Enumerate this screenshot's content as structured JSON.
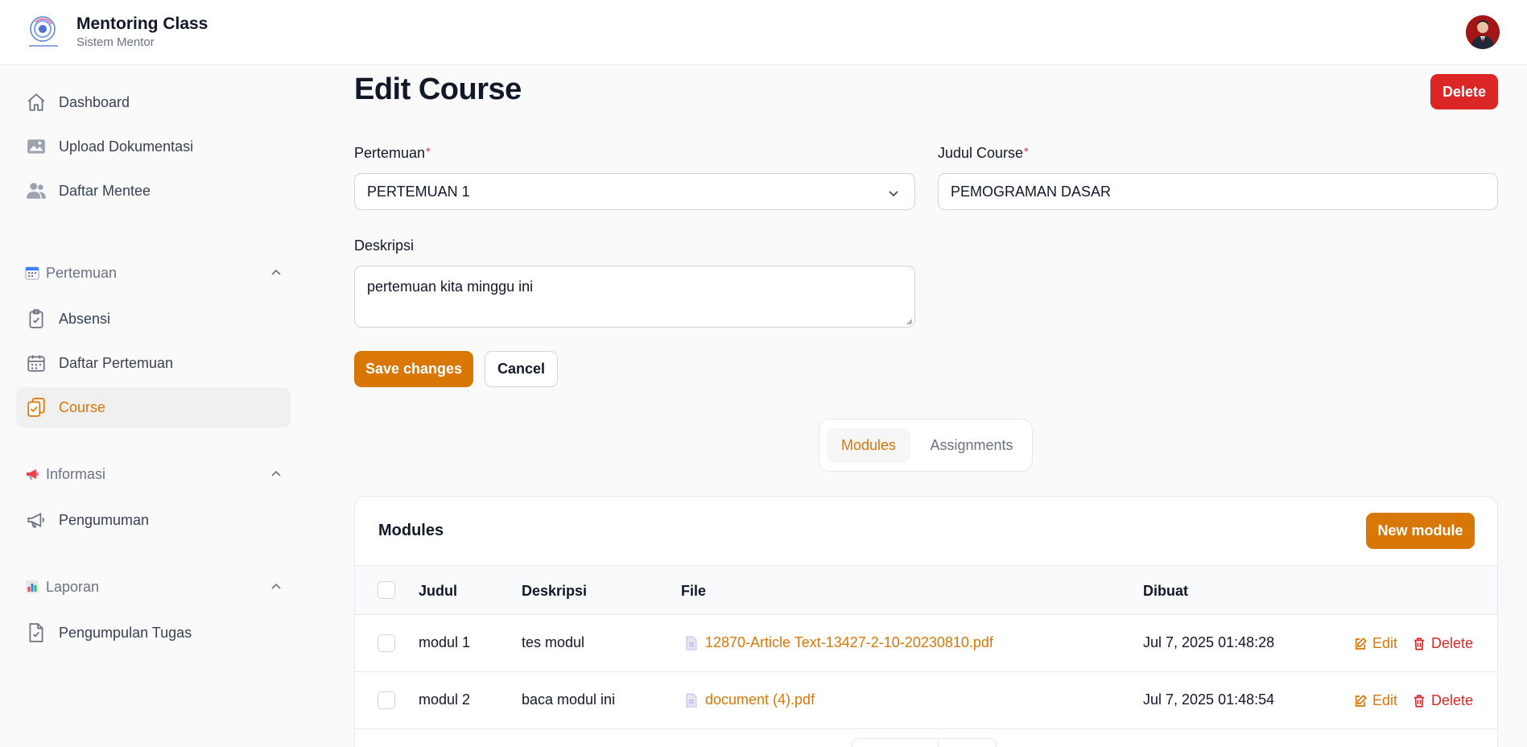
{
  "app": {
    "title": "Mentoring Class",
    "subtitle": "Sistem Mentor"
  },
  "sidebar": {
    "items": [
      {
        "label": "Dashboard",
        "icon": "home-icon"
      },
      {
        "label": "Upload Dokumentasi",
        "icon": "image-icon"
      },
      {
        "label": "Daftar Mentee",
        "icon": "users-icon"
      }
    ],
    "groups": [
      {
        "label": "Pertemuan",
        "icon": "calendar-emoji-icon",
        "items": [
          {
            "label": "Absensi",
            "icon": "clipboard-check-icon"
          },
          {
            "label": "Daftar Pertemuan",
            "icon": "calendar-icon"
          },
          {
            "label": "Course",
            "icon": "clipboard-copy-icon",
            "active": true
          }
        ]
      },
      {
        "label": "Informasi",
        "icon": "megaphone-emoji-icon",
        "items": [
          {
            "label": "Pengumuman",
            "icon": "megaphone-icon"
          }
        ]
      },
      {
        "label": "Laporan",
        "icon": "bar-chart-emoji-icon",
        "items": [
          {
            "label": "Pengumpulan Tugas",
            "icon": "document-check-icon"
          }
        ]
      }
    ]
  },
  "page": {
    "title": "Edit Course",
    "delete_label": "Delete"
  },
  "form": {
    "pertemuan": {
      "label": "Pertemuan",
      "required_mark": "*",
      "value": "PERTEMUAN 1"
    },
    "judul": {
      "label": "Judul Course",
      "required_mark": "*",
      "value": "PEMOGRAMAN DASAR"
    },
    "deskripsi": {
      "label": "Deskripsi",
      "value": "pertemuan kita minggu ini"
    },
    "save_label": "Save changes",
    "cancel_label": "Cancel"
  },
  "tabs": [
    {
      "label": "Modules",
      "active": true
    },
    {
      "label": "Assignments",
      "active": false
    }
  ],
  "modules": {
    "title": "Modules",
    "new_label": "New module",
    "columns": [
      "Judul",
      "Deskripsi",
      "File",
      "Dibuat"
    ],
    "rows": [
      {
        "judul": "modul 1",
        "deskripsi": "tes modul",
        "file": "12870-Article Text-13427-2-10-20230810.pdf",
        "dibuat": "Jul 7, 2025 01:48:28",
        "edit": "Edit",
        "delete": "Delete"
      },
      {
        "judul": "modul 2",
        "deskripsi": "baca modul ini",
        "file": "document (4).pdf",
        "dibuat": "Jul 7, 2025 01:48:54",
        "edit": "Edit",
        "delete": "Delete"
      }
    ]
  },
  "colors": {
    "accent": "#d97706",
    "danger": "#dc2626",
    "muted": "#6b7280"
  }
}
